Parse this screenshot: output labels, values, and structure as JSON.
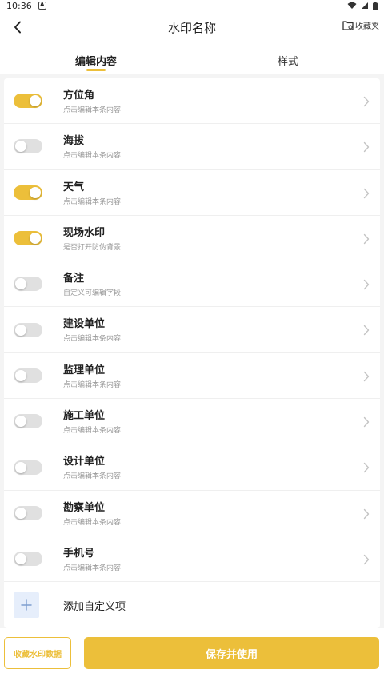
{
  "status": {
    "time": "10:36",
    "notif_letter": "A"
  },
  "header": {
    "title": "水印名称",
    "favorites_label": "收藏夹"
  },
  "tabs": [
    {
      "label": "编辑内容",
      "active": true
    },
    {
      "label": "样式",
      "active": false
    }
  ],
  "items": [
    {
      "title": "方位角",
      "subtitle": "点击编辑本条内容",
      "enabled": true
    },
    {
      "title": "海拔",
      "subtitle": "点击编辑本条内容",
      "enabled": false
    },
    {
      "title": "天气",
      "subtitle": "点击编辑本条内容",
      "enabled": true
    },
    {
      "title": "现场水印",
      "subtitle": "是否打开防伪背景",
      "enabled": true
    },
    {
      "title": "备注",
      "subtitle": "自定义可编辑字段",
      "enabled": false
    },
    {
      "title": "建设单位",
      "subtitle": "点击编辑本条内容",
      "enabled": false
    },
    {
      "title": "监理单位",
      "subtitle": "点击编辑本条内容",
      "enabled": false
    },
    {
      "title": "施工单位",
      "subtitle": "点击编辑本条内容",
      "enabled": false
    },
    {
      "title": "设计单位",
      "subtitle": "点击编辑本条内容",
      "enabled": false
    },
    {
      "title": "勘察单位",
      "subtitle": "点击编辑本条内容",
      "enabled": false
    },
    {
      "title": "手机号",
      "subtitle": "点击编辑本条内容",
      "enabled": false
    }
  ],
  "add_custom": {
    "label": "添加自定义项"
  },
  "buttons": {
    "collect": "收藏水印数据",
    "save": "保存并使用"
  },
  "colors": {
    "accent": "#ecbf3a",
    "toggle_off": "#e0e0e0",
    "add_icon_bg": "#e6eefb"
  }
}
